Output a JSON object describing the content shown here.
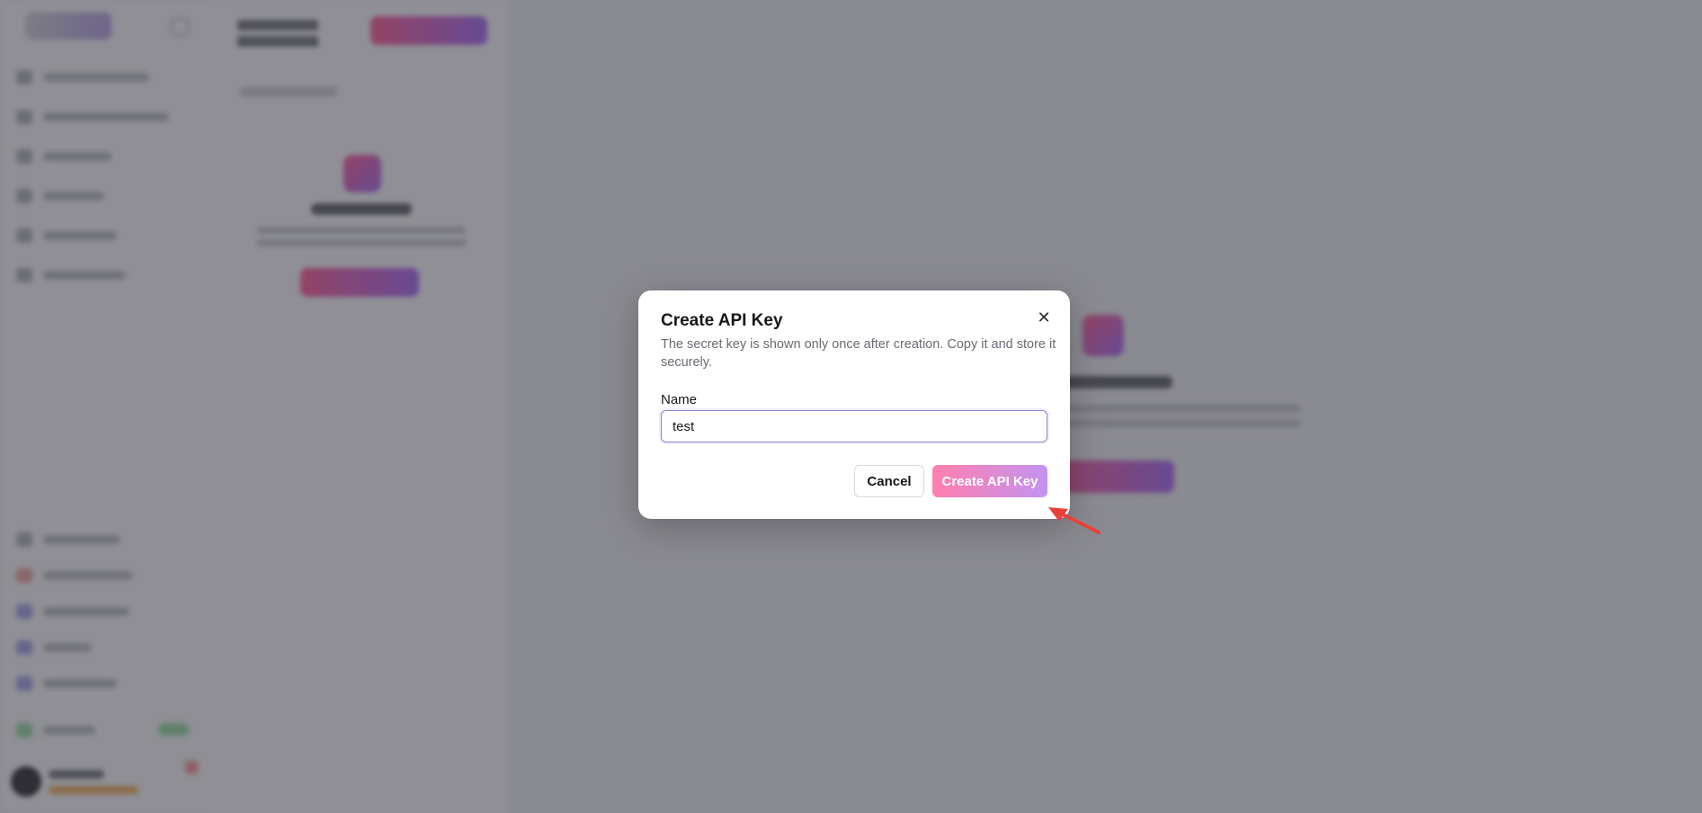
{
  "dialog": {
    "title": "Create API Key",
    "description": "The secret key is shown only once after creation. Copy it and store it securely.",
    "name_label": "Name",
    "name_value": "test",
    "cancel_label": "Cancel",
    "create_label": "Create API Key",
    "close_icon": "close-icon"
  },
  "colors": {
    "accent_start": "#ff7fad",
    "accent_end": "#c493f2",
    "input_border": "#8f86d8",
    "annotation": "#e8413a"
  }
}
